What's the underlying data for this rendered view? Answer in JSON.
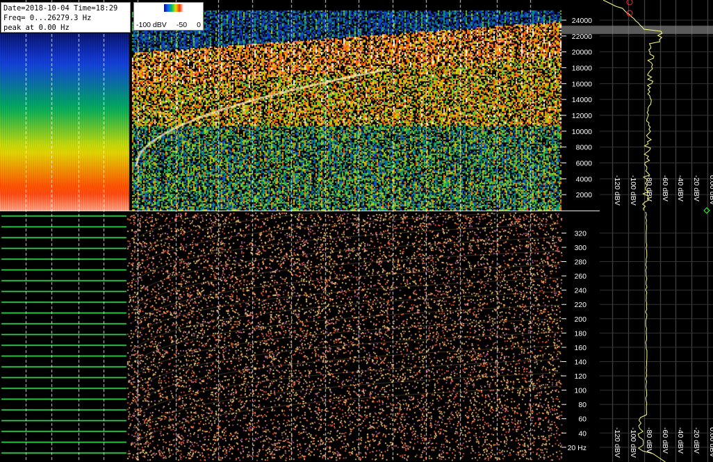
{
  "info": {
    "date_line": "Date=2018-10-04 Time=18:29",
    "freq_line": "Freq= 0...26279.3 Hz",
    "peak_line": "peak at 0.00 Hz"
  },
  "colorbar": {
    "min_label": "-100 dBV",
    "mid_label": "-50",
    "max_label": "0"
  },
  "spectrum_axis": {
    "ticks": [
      {
        "label": "24000",
        "value": 24000
      },
      {
        "label": "22000",
        "value": 22000
      },
      {
        "label": "20000",
        "value": 20000
      },
      {
        "label": "18000",
        "value": 18000
      },
      {
        "label": "16000",
        "value": 16000
      },
      {
        "label": "14000",
        "value": 14000
      },
      {
        "label": "12000",
        "value": 12000
      },
      {
        "label": "10000",
        "value": 10000
      },
      {
        "label": "8000",
        "value": 8000
      },
      {
        "label": "6000",
        "value": 6000
      },
      {
        "label": "4000",
        "value": 4000
      },
      {
        "label": "2000",
        "value": 2000
      }
    ]
  },
  "lowfreq_axis": {
    "ticks": [
      {
        "label": "320",
        "value": 320
      },
      {
        "label": "300",
        "value": 300
      },
      {
        "label": "280",
        "value": 280
      },
      {
        "label": "260",
        "value": 260
      },
      {
        "label": "240",
        "value": 240
      },
      {
        "label": "220",
        "value": 220
      },
      {
        "label": "200",
        "value": 200
      },
      {
        "label": "180",
        "value": 180
      },
      {
        "label": "160",
        "value": 160
      },
      {
        "label": "140",
        "value": 140
      },
      {
        "label": "120",
        "value": 120
      },
      {
        "label": "100",
        "value": 100
      },
      {
        "label": "80",
        "value": 80
      },
      {
        "label": "60",
        "value": 60
      },
      {
        "label": "40",
        "value": 40
      },
      {
        "label": "20 Hz",
        "value": 20
      }
    ]
  },
  "top_level_axis": {
    "labels": [
      "-120 dBV",
      "-100 dBV",
      "-80 dBV",
      "-60 dBV",
      "-40 dBV",
      "-20 dBV",
      "0.00 dBV"
    ]
  },
  "bottom_level_axis": {
    "labels": [
      "-120 dBV",
      "-100 dBV",
      "-80 dBV",
      "-60 dBV",
      "-40 dBV",
      "-20 dBV",
      "0.00 dBV"
    ]
  },
  "colors": {
    "background": "#000000",
    "trace": "#ffff80",
    "marker": "#ff3030",
    "highlight": "#808080",
    "gridline": "#ffffff"
  }
}
